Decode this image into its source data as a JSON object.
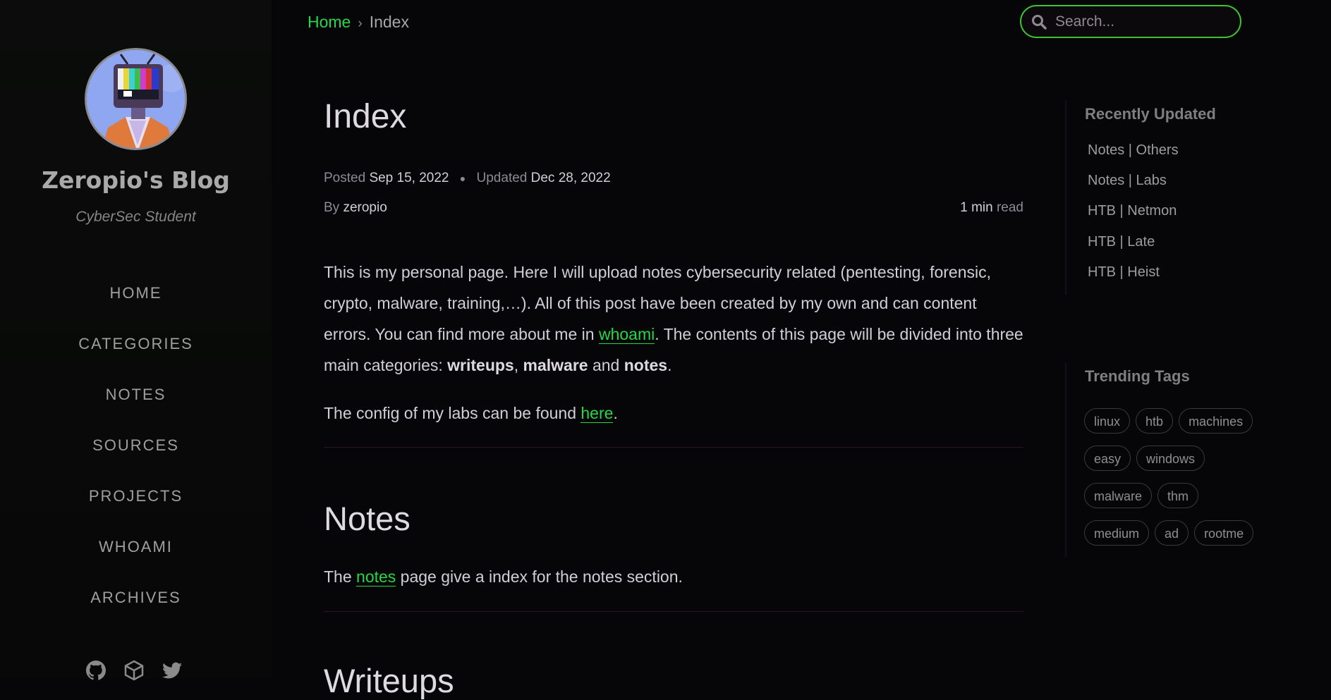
{
  "sidebar": {
    "title": "Zeropio's Blog",
    "subtitle": "CyberSec Student",
    "nav": [
      "HOME",
      "CATEGORIES",
      "NOTES",
      "SOURCES",
      "PROJECTS",
      "WHOAMI",
      "ARCHIVES"
    ],
    "social_icons": [
      "github-icon",
      "hackthebox-icon",
      "twitter-icon"
    ]
  },
  "breadcrumb": {
    "home": "Home",
    "separator": "›",
    "current": "Index"
  },
  "search": {
    "placeholder": "Search..."
  },
  "post": {
    "title": "Index",
    "posted_label": "Posted",
    "posted_date": "Sep 15, 2022",
    "updated_label": "Updated",
    "updated_date": "Dec 28, 2022",
    "by_label": "By",
    "author": "zeropio",
    "read_time": "1 min",
    "read_label": "read",
    "intro_1": "This is my personal page. Here I will upload notes cybersecurity related (pentesting, forensic, crypto, malware, training,…). All of this post have been created by my own and can content errors. You can find more about me in ",
    "intro_link": "whoami",
    "intro_2": ". The contents of this page will be divided into three main categories: ",
    "cat_1": "writeups",
    "comma": ", ",
    "cat_2": "malware",
    "and": " and ",
    "cat_3": "notes",
    "period": ".",
    "labs_text": "The config of my labs can be found ",
    "labs_link": "here",
    "notes_heading": "Notes",
    "notes_text_1": "The ",
    "notes_link": "notes",
    "notes_text_2": " page give a index for the notes section.",
    "writeups_heading": "Writeups"
  },
  "recently_updated": {
    "heading": "Recently Updated",
    "items": [
      "Notes | Others",
      "Notes | Labs",
      "HTB | Netmon",
      "HTB | Late",
      "HTB | Heist"
    ]
  },
  "trending_tags": {
    "heading": "Trending Tags",
    "tags": [
      "linux",
      "htb",
      "machines",
      "easy",
      "windows",
      "malware",
      "thm",
      "medium",
      "ad",
      "rootme"
    ]
  },
  "colors": {
    "accent": "#27d745",
    "background": "#060507"
  }
}
